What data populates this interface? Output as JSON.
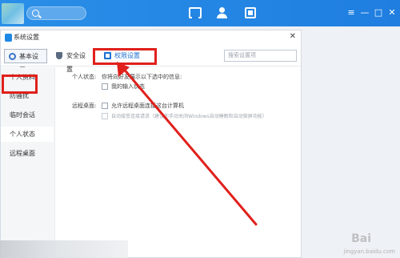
{
  "topbar": {
    "icons": [
      "search-icon",
      "message-icon",
      "contacts-icon",
      "space-icon"
    ],
    "controls": [
      "≡",
      "—",
      "□",
      "✕"
    ]
  },
  "dialog": {
    "title": "系统设置",
    "close": "✕",
    "tabs": [
      {
        "label": "基本设置",
        "icon": "gear-icon"
      },
      {
        "label": "安全设置",
        "icon": "shield-icon"
      },
      {
        "label": "权限设置",
        "icon": "lock-icon"
      }
    ],
    "search_placeholder": "搜索设置项",
    "sidebar": [
      "个人资料",
      "防骚扰",
      "临时会话",
      "个人状态",
      "远程桌面"
    ],
    "active_item": "个人状态",
    "personal_status": {
      "label": "个人状态:",
      "description": "你将向好友展示以下选中的信息:",
      "option": "我的输入状态"
    },
    "remote_desktop": {
      "label": "远程桌面:",
      "option1": "允许远程桌面连接这台计算机",
      "option2": "自动接受连接请求（建议你手动关闭Windows自动睡眠和自动锁屏功能）"
    }
  },
  "highlight_color": "#e0201b",
  "watermark": "jingyan.baidu.com",
  "watermark_logo": "Bai"
}
